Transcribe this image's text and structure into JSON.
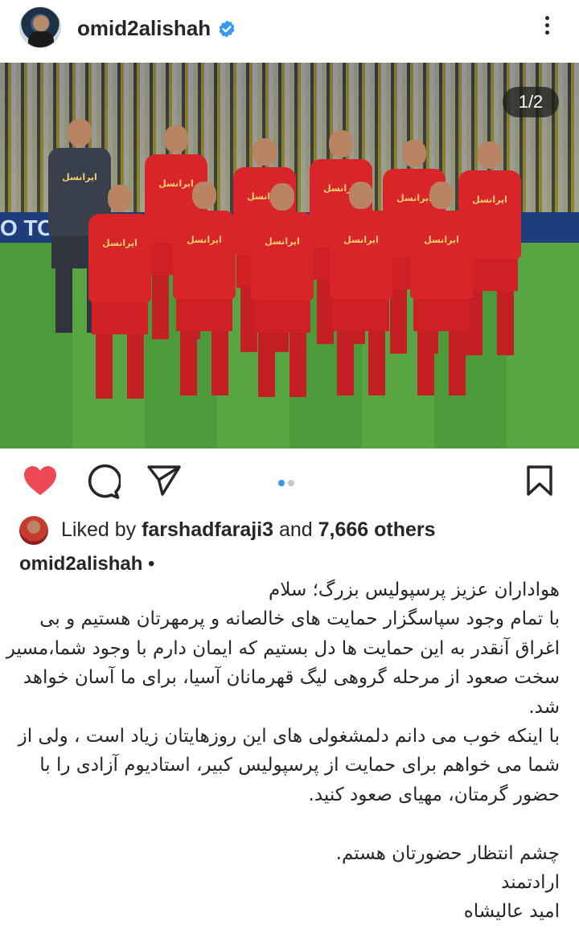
{
  "post": {
    "username": "omid2alishah",
    "verified": true,
    "image_counter": "1/2",
    "carousel": {
      "total": 2,
      "active": 1
    },
    "liked_by_prefix": "Liked by ",
    "liked_by_user": "farshadfaraji3",
    "liked_by_and": " and ",
    "liked_by_others": "7,666 others",
    "caption_user": "omid2alishah",
    "caption_bullet": " •",
    "caption_lines": [
      "هواداران عزیز پرسپولیس بزرگ؛ سلام",
      "با تمام وجود سپاسگزار حمایت های خالصانه و پرمهرتان هستیم و بی",
      "اغراق آنقدر به این حمایت ها دل بستیم که ایمان دارم با وجود شما،مسیر",
      "سخت صعود از مرحله گروهی لیگ قهرمانان آسیا، برای ما آسان خواهد",
      "شد.",
      "با اینکه خوب می دانم دلمشغولی های این روزهایتان زیاد است ، ولی از",
      "شما می خواهم برای حمایت از پرسپولیس کبیر، استادیوم آزادی را با",
      "حضور گرمتان، مهیای صعود کنید.",
      "",
      "چشم انتظار حضورتان هستم.",
      "ارادتمند",
      "امید عالیشاه"
    ],
    "board_text": "O TO",
    "shirt_sponsor": "ایرانسل"
  },
  "colors": {
    "like_red": "#ed4956",
    "verified_blue": "#3897f0",
    "dot_active": "#3897f0",
    "dot_inactive": "#c7c7c7"
  },
  "icons": [
    "heart-icon",
    "comment-icon",
    "share-icon",
    "bookmark-icon",
    "verified-badge-icon",
    "more-options-icon"
  ]
}
